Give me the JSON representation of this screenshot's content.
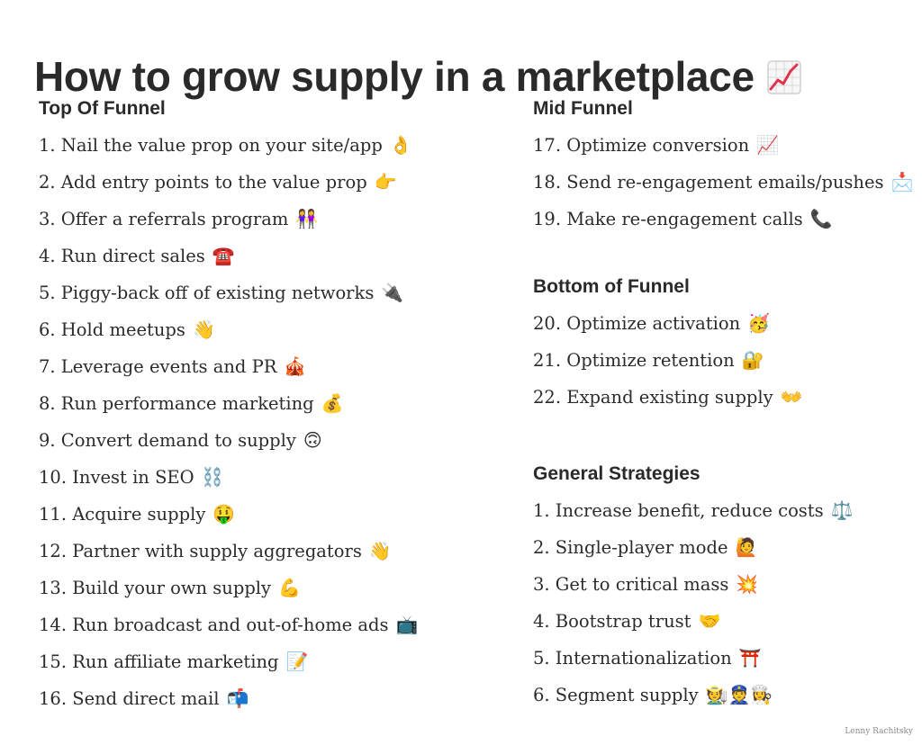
{
  "title": "How to grow supply in a marketplace",
  "credit": "Lenny Rachitsky",
  "sections": {
    "top_of_funnel": {
      "heading": "Top Of Funnel",
      "items": [
        {
          "text": "1. Nail the value prop on your site/app",
          "emoji": "👌"
        },
        {
          "text": "2. Add entry points to the value prop",
          "emoji": "👉"
        },
        {
          "text": "3. Offer a referrals program",
          "emoji": "👭"
        },
        {
          "text": "4. Run direct sales",
          "emoji": "☎️"
        },
        {
          "text": "5. Piggy-back off of existing networks",
          "emoji": "🔌"
        },
        {
          "text": "6. Hold meetups",
          "emoji": "👋"
        },
        {
          "text": "7. Leverage events and PR",
          "emoji": "🎪"
        },
        {
          "text": "8. Run performance marketing",
          "emoji": "💰"
        },
        {
          "text": "9. Convert demand to supply",
          "emoji": "🙃"
        },
        {
          "text": "10. Invest in SEO",
          "emoji": "⛓️"
        },
        {
          "text": "11. Acquire supply",
          "emoji": "🤑"
        },
        {
          "text": "12. Partner with supply aggregators",
          "emoji": "👋"
        },
        {
          "text": "13. Build your own supply",
          "emoji": "💪"
        },
        {
          "text": "14. Run broadcast and out-of-home ads",
          "emoji": "📺"
        },
        {
          "text": "15. Run affiliate marketing",
          "emoji": "📝"
        },
        {
          "text": "16. Send direct mail",
          "emoji": "📬"
        }
      ]
    },
    "mid_funnel": {
      "heading": "Mid Funnel",
      "items": [
        {
          "text": "17. Optimize conversion",
          "emoji": "📈"
        },
        {
          "text": "18. Send re-engagement emails/pushes",
          "emoji": "📩"
        },
        {
          "text": "19. Make re-engagement calls",
          "emoji": "📞"
        }
      ]
    },
    "bottom_of_funnel": {
      "heading": "Bottom of Funnel",
      "items": [
        {
          "text": "20. Optimize activation",
          "emoji": "🥳"
        },
        {
          "text": "21. Optimize retention",
          "emoji": "🔐"
        },
        {
          "text": "22. Expand existing supply",
          "emoji": "👐"
        }
      ]
    },
    "general_strategies": {
      "heading": "General Strategies",
      "items": [
        {
          "text": "1. Increase benefit, reduce costs",
          "emoji": "⚖️"
        },
        {
          "text": "2. Single-player mode",
          "emoji": "🙋"
        },
        {
          "text": "3. Get to critical mass",
          "emoji": "💥"
        },
        {
          "text": "4. Bootstrap trust",
          "emoji": "🤝"
        },
        {
          "text": "5. Internationalization",
          "emoji": "⛩️"
        },
        {
          "text": "6. Segment supply",
          "emoji": "🧑‍🌾👮👩‍🍳"
        }
      ]
    }
  }
}
